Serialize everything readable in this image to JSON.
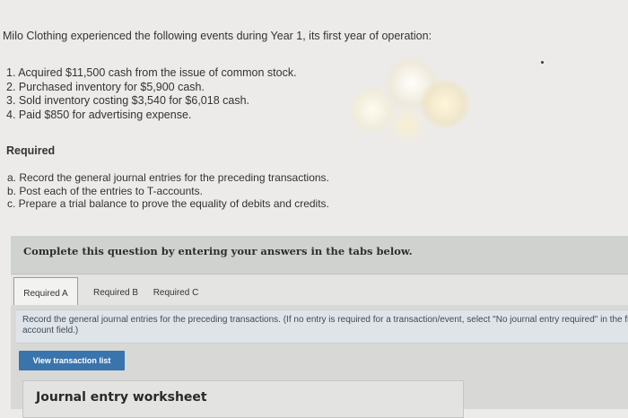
{
  "problem": {
    "intro": "Milo Clothing experienced the following events during Year 1, its first year of operation:",
    "events": [
      "1. Acquired $11,500 cash from the issue of common stock.",
      "2. Purchased inventory for $5,900 cash.",
      "3. Sold inventory costing $3,540 for $6,018 cash.",
      "4. Paid $850 for advertising expense."
    ],
    "required_heading": "Required",
    "tasks": [
      "a. Record the general journal entries for the preceding transactions.",
      "b. Post each of the entries to T-accounts.",
      "c. Prepare a trial balance to prove the equality of debits and credits."
    ]
  },
  "panel": {
    "header": "Complete this question by entering your answers in the tabs below.",
    "tabs": [
      {
        "label": "Required A",
        "active": true
      },
      {
        "label": "Required B",
        "active": false
      },
      {
        "label": "Required C",
        "active": false
      }
    ],
    "instruction": "Record the general journal entries for the preceding transactions. (If no entry is required for a transaction/event, select \"No journal entry required\" in the first account field.)",
    "view_button": "View transaction list",
    "worksheet_title": "Journal entry worksheet"
  },
  "colors": {
    "button": "#3a74ad",
    "instruction_text": "#3e4a5a"
  }
}
